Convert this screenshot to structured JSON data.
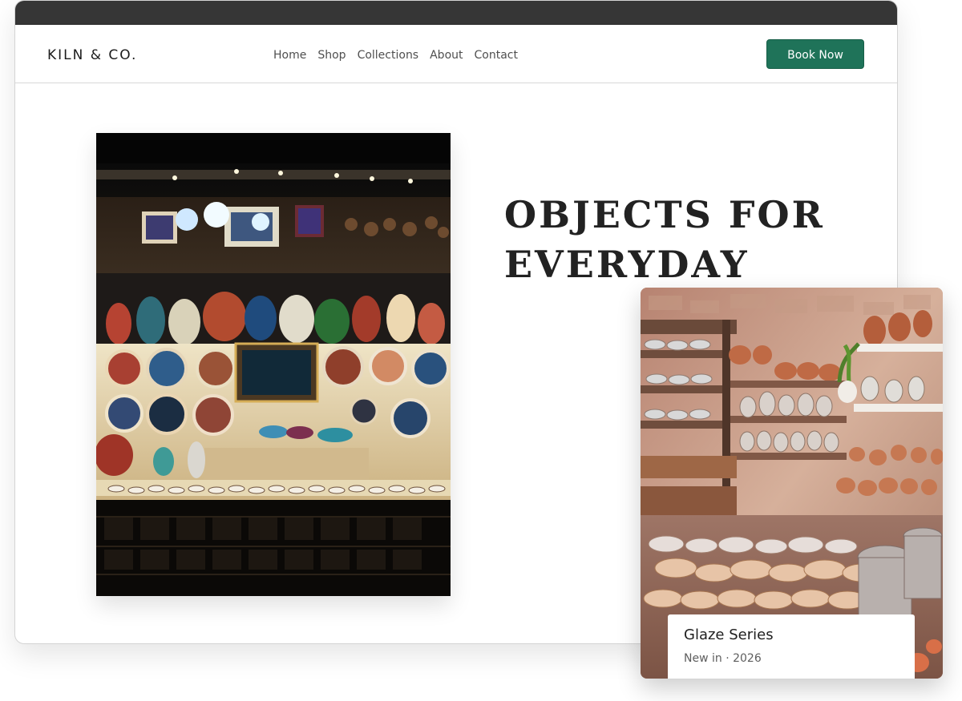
{
  "brand": {
    "name": "KILN & CO."
  },
  "nav": {
    "links": [
      "Home",
      "Shop",
      "Collections",
      "About",
      "Contact"
    ],
    "cta_label": "Book Now"
  },
  "hero": {
    "title_line1": "OBJECTS FOR",
    "title_line2": "EVERYDAY",
    "image_icon": "pottery-shop-display-image"
  },
  "feature": {
    "title": "Glaze Series",
    "meta": "New in · 2026",
    "image_icon": "terracotta-pottery-shelves-image"
  },
  "colors": {
    "accent": "#1f7359",
    "titlebar": "#363636",
    "text": "#222222"
  }
}
